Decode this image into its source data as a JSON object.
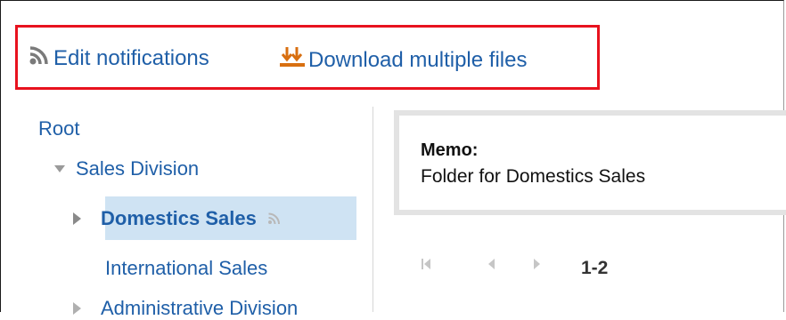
{
  "toolbar": {
    "edit_notifications": "Edit notifications",
    "download_multiple_files": "Download multiple files"
  },
  "tree": {
    "root": "Root",
    "sales_division": "Sales Division",
    "domestics_sales": "Domestics Sales",
    "international_sales": "International Sales",
    "administrative_division": "Administrative Division"
  },
  "memo": {
    "label": "Memo:",
    "text": "Folder for Domestics Sales"
  },
  "pager": {
    "range": "1-2"
  },
  "colors": {
    "link": "#1f5fa8",
    "highlight": "#e8121e",
    "selected_bg": "#cfe3f3"
  }
}
